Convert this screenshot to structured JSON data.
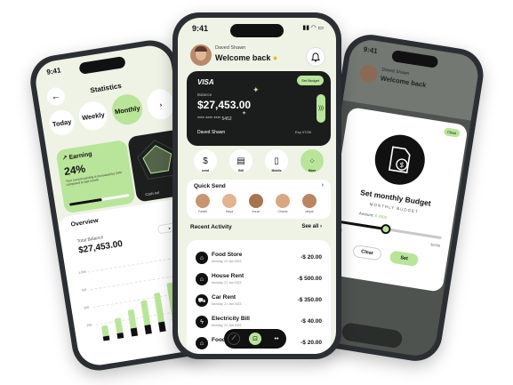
{
  "left_phone": {
    "time": "9:41",
    "title": "Statistics",
    "periods": [
      {
        "label": "Today",
        "active": false
      },
      {
        "label": "Weekly",
        "active": false
      },
      {
        "label": "Monthly",
        "active": true
      }
    ],
    "earning": {
      "title": "Earning",
      "percent": "24%",
      "note": "Your current earning is increased by 24% compared to last month"
    },
    "chart_card_label": "Cash out",
    "overview_label": "Overview",
    "total_label": "Total Balance",
    "total_value": "$27,453.00",
    "chart_data": {
      "type": "bar",
      "y_ticks": [
        "1,000",
        "750",
        "500",
        "250"
      ],
      "series": [
        {
          "values": [
            0.25,
            0.35,
            0.45,
            0.6,
            0.7,
            0.85,
            1.0
          ]
        },
        {
          "values": [
            0.1,
            0.12,
            0.18,
            0.2,
            0.22,
            0.25,
            0.2
          ]
        }
      ]
    }
  },
  "center_phone": {
    "time": "9:41",
    "user_name": "Daved Shawn",
    "greeting": "Welcome back",
    "card": {
      "brand": "VISA",
      "set_budget_label": "Set Budget",
      "balance_label": "Balance",
      "balance_value": "$27,453.00",
      "card_number": "**** **** **** 5452",
      "holder": "Daved Shawn",
      "expiry": "Exp 07/26"
    },
    "actions": [
      {
        "label": "send",
        "active": false
      },
      {
        "label": "Bill",
        "active": false
      },
      {
        "label": "Mobile",
        "active": false
      },
      {
        "label": "More",
        "active": true
      }
    ],
    "quick_send": {
      "title": "Quick Send",
      "contacts": [
        "Farabi",
        "Naya",
        "Imran",
        "Chams",
        "lafiyal"
      ]
    },
    "recent": {
      "title": "Recent Activity",
      "see_all": "See all",
      "items": [
        {
          "name": "Food Store",
          "date": "Monday, 21 Jan 2023",
          "amount": "-$ 20.00"
        },
        {
          "name": "House Rent",
          "date": "Monday, 21 Jan 2023",
          "amount": "-$ 500.00"
        },
        {
          "name": "Car Rent",
          "date": "Monday, 21 Jan 2023",
          "amount": "-$ 350.00"
        },
        {
          "name": "Electricity Bill",
          "date": "Monday, 21 Jan 2023",
          "amount": "-$ 40.00"
        },
        {
          "name": "Food",
          "date": "",
          "amount": "-$ 20.00"
        }
      ]
    }
  },
  "right_phone": {
    "time": "9:41",
    "user_name": "Daved Shawn",
    "greeting": "Welcome back",
    "close_label": "Close",
    "budget_title": "Set monthly Budget",
    "budget_sub": "MONTHLY BUDGET",
    "amount_label": "Amount:",
    "amount_value": "$ 4000",
    "slider_value": 0.45,
    "slider_min": "$0",
    "slider_max": "$5000",
    "clear_label": "Clear",
    "set_label": "Set"
  },
  "colors": {
    "accent": "#b9e59a",
    "dark": "#111111",
    "bg": "#eef3e6"
  }
}
